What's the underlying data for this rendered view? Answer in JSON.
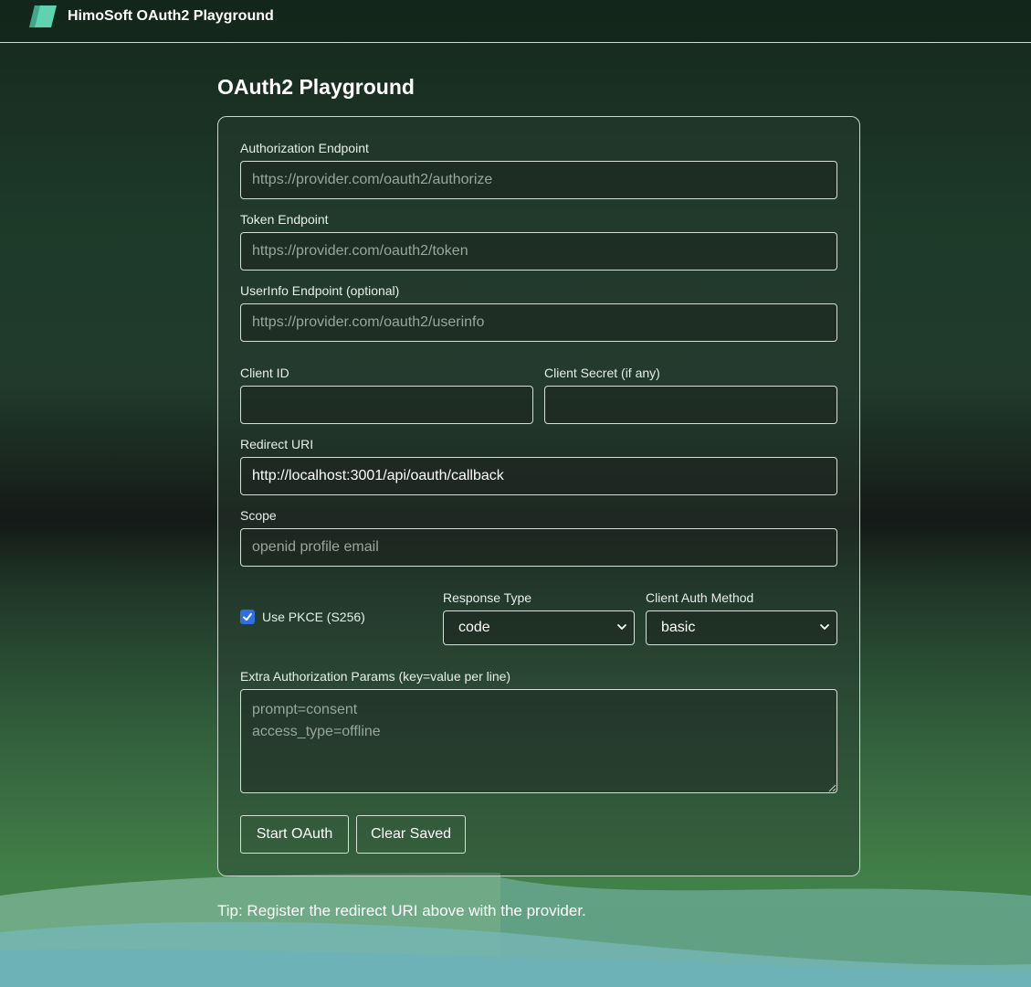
{
  "header": {
    "brand": "HimoSoft OAuth2 Playground",
    "logo_icon": "parallelogram-logo-icon"
  },
  "page": {
    "title": "OAuth2 Playground"
  },
  "form": {
    "auth_endpoint": {
      "label": "Authorization Endpoint",
      "placeholder": "https://provider.com/oauth2/authorize",
      "value": ""
    },
    "token_endpoint": {
      "label": "Token Endpoint",
      "placeholder": "https://provider.com/oauth2/token",
      "value": ""
    },
    "userinfo_endpoint": {
      "label": "UserInfo Endpoint (optional)",
      "placeholder": "https://provider.com/oauth2/userinfo",
      "value": ""
    },
    "client_id": {
      "label": "Client ID",
      "value": ""
    },
    "client_secret": {
      "label": "Client Secret (if any)",
      "value": ""
    },
    "redirect_uri": {
      "label": "Redirect URI",
      "value": "http://localhost:3001/api/oauth/callback"
    },
    "scope": {
      "label": "Scope",
      "placeholder": "openid profile email",
      "value": ""
    },
    "pkce": {
      "label": "Use PKCE (S256)",
      "checked": true
    },
    "response_type": {
      "label": "Response Type",
      "selected": "code"
    },
    "client_auth_method": {
      "label": "Client Auth Method",
      "selected": "basic"
    },
    "extra_params": {
      "label": "Extra Authorization Params (key=value per line)",
      "placeholder": "prompt=consent\naccess_type=offline",
      "value": ""
    },
    "start_button": "Start OAuth",
    "clear_button": "Clear Saved"
  },
  "tip": "Tip: Register the redirect URI above with the provider.",
  "colors": {
    "accent_checkbox": "#2d6fe6",
    "logo": "#5fd3b0"
  }
}
